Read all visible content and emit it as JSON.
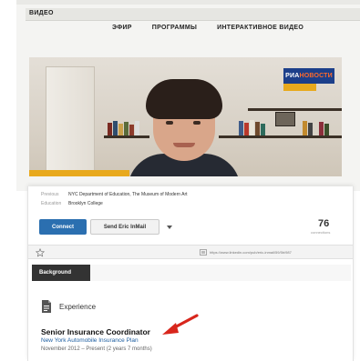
{
  "video_site": {
    "section_title": "ВИДЕО",
    "nav": [
      "ЭФИР",
      "ПРОГРАММЫ",
      "ИНТЕРАКТИВНОЕ ВИДЕО"
    ],
    "logo": {
      "text_main": "РИА",
      "text_accent": "НОВОСТИ"
    }
  },
  "profile": {
    "details": [
      {
        "label": "Previous",
        "value": "NYC Department of Education, The Museum of Modern Art"
      },
      {
        "label": "Education",
        "value": "Brooklyn College"
      }
    ],
    "connect_label": "Connect",
    "send_label": "Send Eric InMail",
    "connections_count": "76",
    "connections_label": "connections"
  },
  "urlbar": {
    "url": "https://www.linkedin.com/pub/eric-inmail/59/5b/987"
  },
  "background": {
    "tab_label": "Background",
    "section_label": "Experience",
    "job": {
      "title": "Senior Insurance Coordinator",
      "company": "New York Automobile Insurance Plan",
      "dates": "November 2012 – Present (2 years 7 months)"
    }
  },
  "colors": {
    "connect_blue": "#2b6fb0",
    "annotation_red": "#d8261c",
    "logo_blue": "#1c3f8a",
    "lower_third_orange": "#e8a91d"
  },
  "icons": [
    "star-icon",
    "lock-icon",
    "chevron-down-icon",
    "document-icon",
    "red-arrow-icon"
  ]
}
